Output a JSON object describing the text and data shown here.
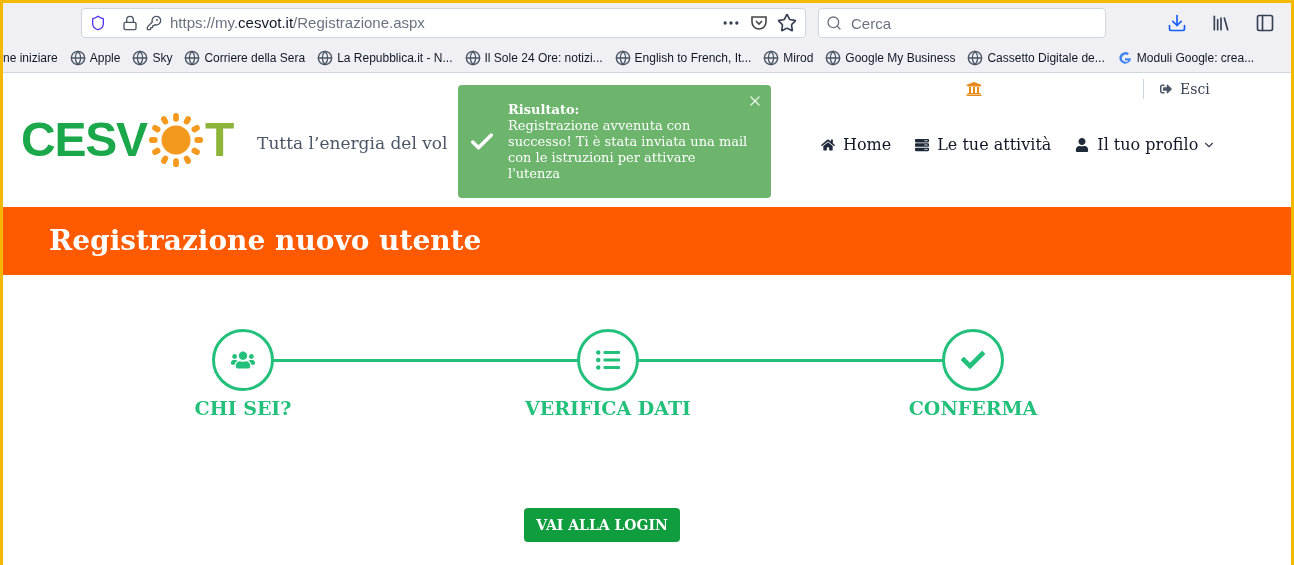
{
  "browser": {
    "url_prefix": "https://my.",
    "url_domain": "cesvot.it",
    "url_path": "/Registrazione.aspx",
    "search_placeholder": "Cerca"
  },
  "bookmarks": [
    {
      "label": "ne iniziare",
      "kind": "plain"
    },
    {
      "label": "Apple",
      "kind": "globe"
    },
    {
      "label": "Sky",
      "kind": "globe"
    },
    {
      "label": "Corriere della Sera",
      "kind": "globe"
    },
    {
      "label": "La Repubblica.it - N...",
      "kind": "globe"
    },
    {
      "label": "Il Sole 24 Ore: notizi...",
      "kind": "globe"
    },
    {
      "label": "English to French, It...",
      "kind": "globe"
    },
    {
      "label": "Mirod",
      "kind": "globe"
    },
    {
      "label": "Google My Business",
      "kind": "globe"
    },
    {
      "label": "Cassetto Digitale de...",
      "kind": "globe"
    },
    {
      "label": "Moduli Google: crea...",
      "kind": "google"
    }
  ],
  "site": {
    "logo_left": "CESV",
    "logo_right": "T",
    "tagline": "Tutta l’energia del vol",
    "logout": "Esci",
    "nav": [
      {
        "label": "Home",
        "kind": "home"
      },
      {
        "label": "Le tue attività",
        "kind": "list"
      },
      {
        "label": "Il tuo profilo",
        "kind": "user",
        "dropdown": true
      }
    ]
  },
  "toast": {
    "title": "Risultato:",
    "message": "Registrazione avvenuta con successo! Ti è stata inviata una mail con le istruzioni per attivare l'utenza"
  },
  "banner": {
    "title": "Registrazione nuovo utente"
  },
  "steps": [
    {
      "label": "CHI SEI?",
      "kind": "users"
    },
    {
      "label": "VERIFICA DATI",
      "kind": "list"
    },
    {
      "label": "CONFERMA",
      "kind": "check"
    }
  ],
  "login_button": "VAI ALLA LOGIN"
}
